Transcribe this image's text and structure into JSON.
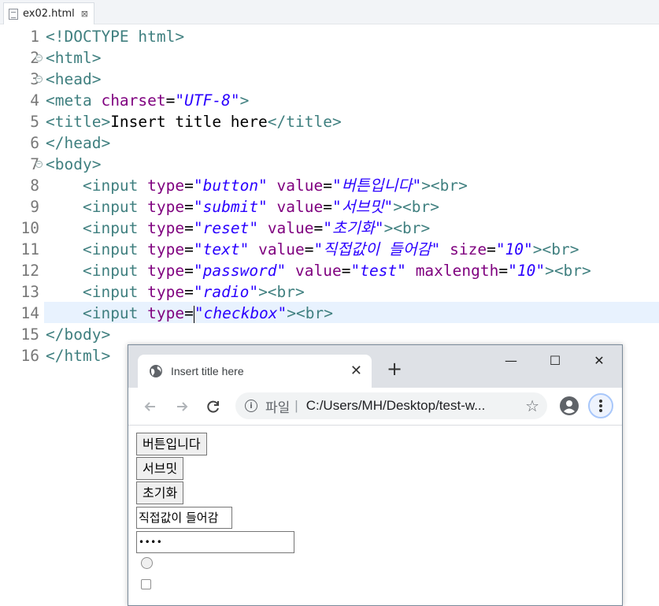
{
  "editor": {
    "tab_label": "ex02.html",
    "tab_close": "⊠",
    "lines": [
      {
        "num": "1",
        "parts": [
          {
            "c": "tag",
            "t": "<!DOCTYPE html>"
          }
        ]
      },
      {
        "num": "2",
        "fold": "⊖",
        "parts": [
          {
            "c": "tag",
            "t": "<html>"
          }
        ]
      },
      {
        "num": "3",
        "fold": "⊖",
        "parts": [
          {
            "c": "tag",
            "t": "<head>"
          }
        ]
      },
      {
        "num": "4",
        "parts": [
          {
            "c": "tag",
            "t": "<meta "
          },
          {
            "c": "attr",
            "t": "charset"
          },
          {
            "c": "txt",
            "t": "="
          },
          {
            "c": "val",
            "t": "\"UTF-8\""
          },
          {
            "c": "tag",
            "t": ">"
          }
        ]
      },
      {
        "num": "5",
        "parts": [
          {
            "c": "tag",
            "t": "<title>"
          },
          {
            "c": "txt",
            "t": "Insert title here"
          },
          {
            "c": "tag",
            "t": "</title>"
          }
        ]
      },
      {
        "num": "6",
        "parts": [
          {
            "c": "tag",
            "t": "</head>"
          }
        ]
      },
      {
        "num": "7",
        "fold": "⊖",
        "parts": [
          {
            "c": "tag",
            "t": "<body>"
          }
        ]
      },
      {
        "num": "8",
        "parts": [
          {
            "c": "txt",
            "t": "    "
          },
          {
            "c": "tag",
            "t": "<input "
          },
          {
            "c": "attr",
            "t": "type"
          },
          {
            "c": "txt",
            "t": "="
          },
          {
            "c": "val",
            "t": "\"button\""
          },
          {
            "c": "txt",
            "t": " "
          },
          {
            "c": "attr",
            "t": "value"
          },
          {
            "c": "txt",
            "t": "="
          },
          {
            "c": "val",
            "t": "\"버튼입니다\""
          },
          {
            "c": "tag",
            "t": "><br>"
          }
        ]
      },
      {
        "num": "9",
        "parts": [
          {
            "c": "txt",
            "t": "    "
          },
          {
            "c": "tag",
            "t": "<input "
          },
          {
            "c": "attr",
            "t": "type"
          },
          {
            "c": "txt",
            "t": "="
          },
          {
            "c": "val",
            "t": "\"submit\""
          },
          {
            "c": "txt",
            "t": " "
          },
          {
            "c": "attr",
            "t": "value"
          },
          {
            "c": "txt",
            "t": "="
          },
          {
            "c": "val",
            "t": "\"서브밋\""
          },
          {
            "c": "tag",
            "t": "><br>"
          }
        ]
      },
      {
        "num": "10",
        "parts": [
          {
            "c": "txt",
            "t": "    "
          },
          {
            "c": "tag",
            "t": "<input "
          },
          {
            "c": "attr",
            "t": "type"
          },
          {
            "c": "txt",
            "t": "="
          },
          {
            "c": "val",
            "t": "\"reset\""
          },
          {
            "c": "txt",
            "t": " "
          },
          {
            "c": "attr",
            "t": "value"
          },
          {
            "c": "txt",
            "t": "="
          },
          {
            "c": "val",
            "t": "\"초기화\""
          },
          {
            "c": "tag",
            "t": "><br>"
          }
        ]
      },
      {
        "num": "11",
        "parts": [
          {
            "c": "txt",
            "t": "    "
          },
          {
            "c": "tag",
            "t": "<input "
          },
          {
            "c": "attr",
            "t": "type"
          },
          {
            "c": "txt",
            "t": "="
          },
          {
            "c": "val",
            "t": "\"text\""
          },
          {
            "c": "txt",
            "t": " "
          },
          {
            "c": "attr",
            "t": "value"
          },
          {
            "c": "txt",
            "t": "="
          },
          {
            "c": "val",
            "t": "\"직접값이 들어감\""
          },
          {
            "c": "txt",
            "t": " "
          },
          {
            "c": "attr",
            "t": "size"
          },
          {
            "c": "txt",
            "t": "="
          },
          {
            "c": "val",
            "t": "\"10\""
          },
          {
            "c": "tag",
            "t": "><br>"
          }
        ]
      },
      {
        "num": "12",
        "parts": [
          {
            "c": "txt",
            "t": "    "
          },
          {
            "c": "tag",
            "t": "<input "
          },
          {
            "c": "attr",
            "t": "type"
          },
          {
            "c": "txt",
            "t": "="
          },
          {
            "c": "val",
            "t": "\"password\""
          },
          {
            "c": "txt",
            "t": " "
          },
          {
            "c": "attr",
            "t": "value"
          },
          {
            "c": "txt",
            "t": "="
          },
          {
            "c": "val",
            "t": "\"test\""
          },
          {
            "c": "txt",
            "t": " "
          },
          {
            "c": "attr",
            "t": "maxlength"
          },
          {
            "c": "txt",
            "t": "="
          },
          {
            "c": "val",
            "t": "\"10\""
          },
          {
            "c": "tag",
            "t": "><br>"
          }
        ]
      },
      {
        "num": "13",
        "parts": [
          {
            "c": "txt",
            "t": "    "
          },
          {
            "c": "tag",
            "t": "<input "
          },
          {
            "c": "attr",
            "t": "type"
          },
          {
            "c": "txt",
            "t": "="
          },
          {
            "c": "val",
            "t": "\"radio\""
          },
          {
            "c": "tag",
            "t": "><br>"
          }
        ]
      },
      {
        "num": "14",
        "caret": true,
        "parts": [
          {
            "c": "txt",
            "t": "    "
          },
          {
            "c": "tag",
            "t": "<input "
          },
          {
            "c": "attr",
            "t": "type"
          },
          {
            "c": "txt",
            "t": "="
          },
          {
            "c": "val",
            "t": "\"checkbox\""
          },
          {
            "c": "tag",
            "t": "><br>"
          }
        ]
      },
      {
        "num": "15",
        "parts": [
          {
            "c": "tag",
            "t": "</body>"
          }
        ]
      },
      {
        "num": "16",
        "parts": [
          {
            "c": "tag",
            "t": "</html>"
          }
        ]
      }
    ]
  },
  "browser": {
    "tab_title": "Insert title here",
    "tab_close": "✕",
    "new_tab": "+",
    "minimize": "—",
    "maximize": "☐",
    "close": "✕",
    "address_scheme": "파일",
    "address_sep": "|",
    "address_path": "C:/Users/MH/Desktop/test-w...",
    "star": "☆",
    "page": {
      "button_value": "버튼입니다",
      "submit_value": "서브밋",
      "reset_value": "초기화",
      "text_value": "직접값이 들어감",
      "password_value": "••••"
    }
  },
  "colors": {
    "tag": "#3f7f7f",
    "attribute": "#7f007f",
    "string": "#2a00ff",
    "current_line": "#e8f2fe",
    "chrome_frame": "#dee1e6"
  }
}
